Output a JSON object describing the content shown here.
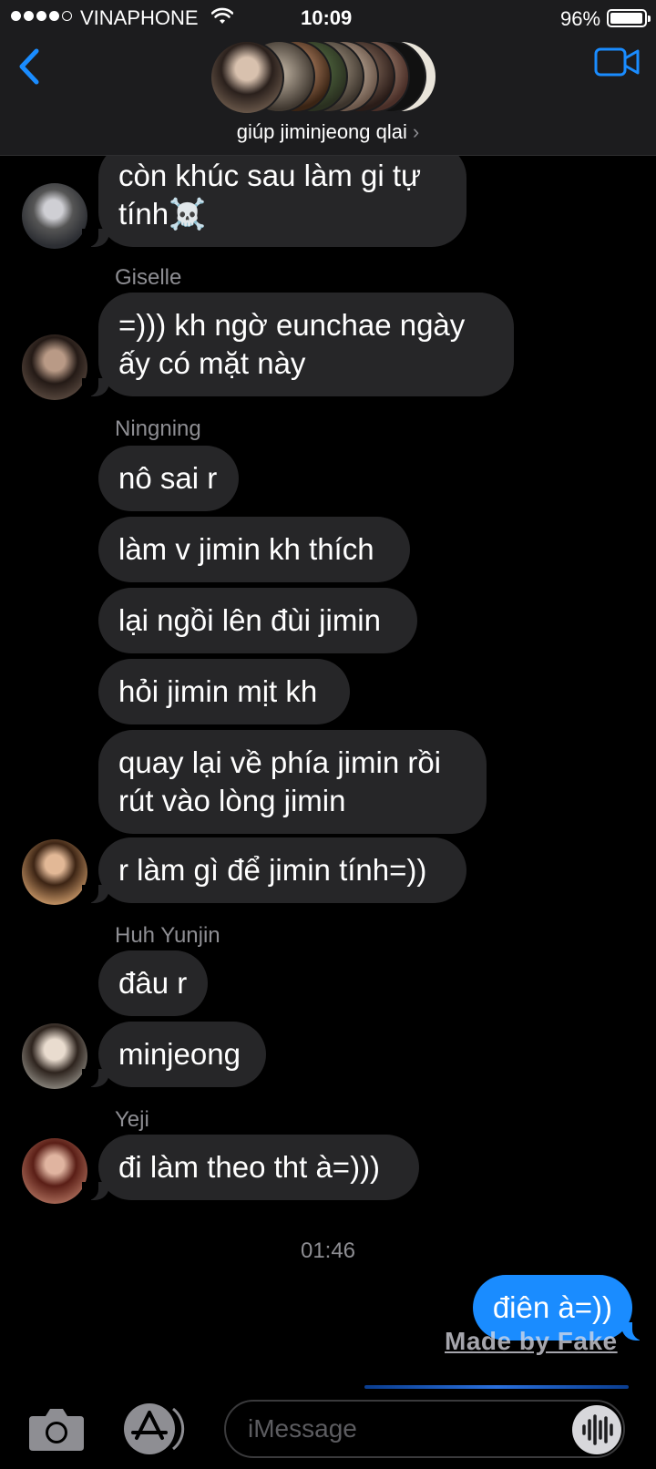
{
  "status_bar": {
    "carrier": "VINAPHONE",
    "time": "10:09",
    "battery_percent_label": "96%",
    "battery_level": 0.96
  },
  "header": {
    "group_name": "giúp jiminjeong qlai",
    "chevron": "›",
    "back_icon": "chevron-left-icon",
    "video_icon": "video-camera-icon",
    "accent_color": "#1a8cff"
  },
  "messages": [
    {
      "sender": "",
      "text_lines": [
        "còn khúc sau làm gi tự",
        "tính☠️"
      ]
    },
    {
      "sender": "Giselle",
      "text_lines": [
        "=))) kh ngờ eunchae ngày",
        "ấy có mặt này"
      ]
    },
    {
      "sender": "Ningning",
      "text_lines": [
        "nô sai r"
      ]
    },
    {
      "sender": "",
      "text_lines": [
        "làm v jimin kh thích"
      ]
    },
    {
      "sender": "",
      "text_lines": [
        "lại ngồi lên đùi jimin"
      ]
    },
    {
      "sender": "",
      "text_lines": [
        "hỏi jimin mịt kh"
      ]
    },
    {
      "sender": "",
      "text_lines": [
        "quay lại về phía jimin rồi",
        "rút vào lòng jimin"
      ]
    },
    {
      "sender": "",
      "text_lines": [
        "r làm gì để jimin tính=))"
      ]
    },
    {
      "sender": "Huh Yunjin",
      "text_lines": [
        "đâu r"
      ]
    },
    {
      "sender": "",
      "text_lines": [
        "minjeong"
      ]
    },
    {
      "sender": "Yeji",
      "text_lines": [
        "đi làm theo tht à=)))"
      ]
    }
  ],
  "timestamp": "01:46",
  "outgoing": {
    "text": "điên à=))",
    "bubble_color": "#1a8cff"
  },
  "watermark": "Made by Fake",
  "input_bar": {
    "placeholder": "iMessage",
    "camera_icon": "camera-icon",
    "appstore_icon": "app-store-icon",
    "audio_icon": "audio-waveform-icon"
  },
  "colors": {
    "incoming_bubble": "#262628",
    "header_bg": "#1c1c1e",
    "secondary_text": "#8e8e93"
  }
}
